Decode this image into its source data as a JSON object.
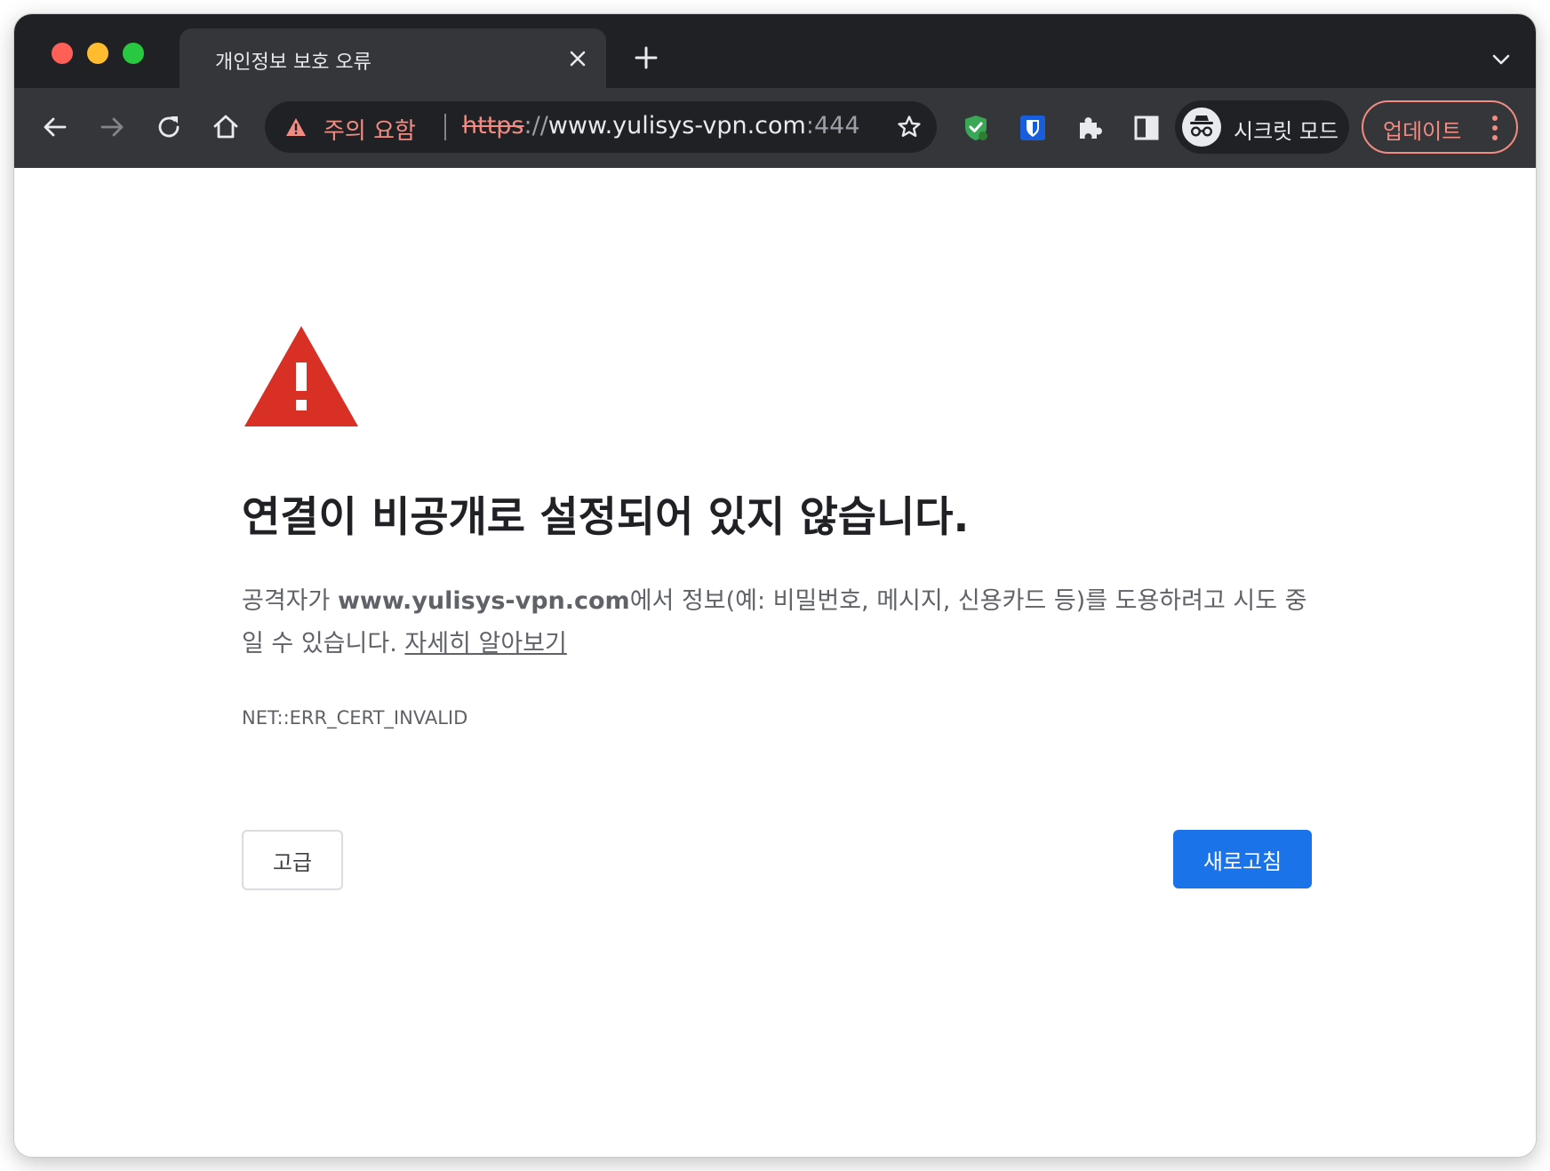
{
  "tab": {
    "title": "개인정보 보호 오류"
  },
  "omnibox": {
    "security_label": "주의 요함",
    "url_scheme": "https",
    "url_separator": "://",
    "url_host": "www.yulisys-vpn.com",
    "url_port": ":444"
  },
  "profile": {
    "label": "시크릿 모드"
  },
  "update": {
    "label": "업데이트"
  },
  "page": {
    "heading": "연결이 비공개로 설정되어 있지 않습니다.",
    "para_prefix": "공격자가 ",
    "para_domain": "www.yulisys-vpn.com",
    "para_suffix": "에서 정보(예: 비밀번호, 메시지, 신용카드 등)를 도용하려고 시도 중일 수 있습니다. ",
    "learn_more": "자세히 알아보기",
    "error_code": "NET::ERR_CERT_INVALID",
    "advanced_button": "고급",
    "reload_button": "새로고침"
  },
  "colors": {
    "accent_blue": "#1a73e8",
    "warning_red": "#d93025",
    "omnibox_warning": "#f28b82",
    "toolbar": "#35363a",
    "tabstrip": "#202124"
  },
  "icons": [
    "close-icon",
    "plus-icon",
    "chevron-down-icon",
    "back-arrow-icon",
    "forward-arrow-icon",
    "reload-icon",
    "home-icon",
    "warning-triangle-icon",
    "star-icon",
    "shield-extension-icon",
    "bitwarden-icon",
    "puzzle-icon",
    "side-panel-icon",
    "incognito-icon",
    "more-vert-icon"
  ]
}
